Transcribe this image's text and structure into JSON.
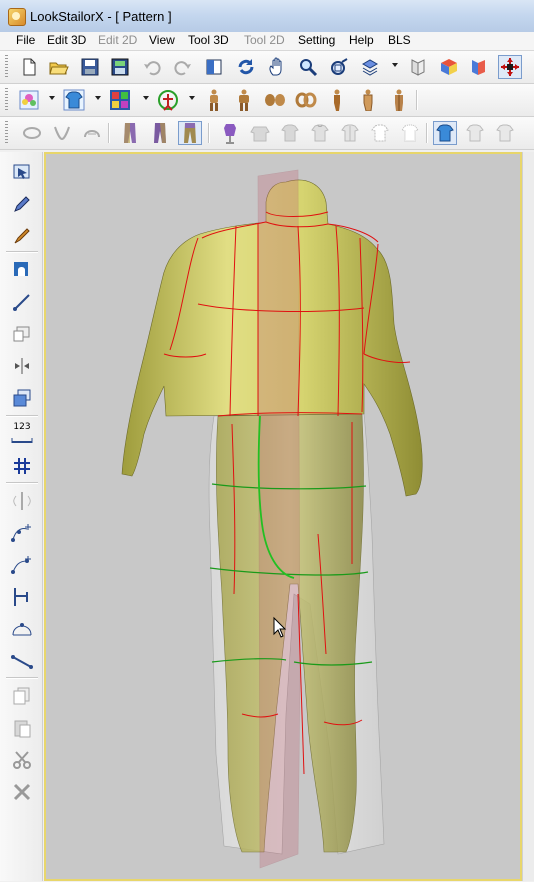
{
  "window": {
    "title": "LookStailorX - [ Pattern  ]"
  },
  "menu": [
    {
      "label": "File",
      "enabled": true
    },
    {
      "label": "Edit 3D",
      "enabled": true
    },
    {
      "label": "Edit 2D",
      "enabled": false
    },
    {
      "label": "View",
      "enabled": true
    },
    {
      "label": "Tool 3D",
      "enabled": true
    },
    {
      "label": "Tool 2D",
      "enabled": false
    },
    {
      "label": "Setting",
      "enabled": true
    },
    {
      "label": "Help",
      "enabled": true
    },
    {
      "label": "BLS",
      "enabled": true
    }
  ],
  "toolbar_main": [
    "new-icon",
    "open-icon",
    "save-icon",
    "save-all-icon",
    "undo-icon",
    "redo-icon",
    "split-view-icon",
    "rotate-icon",
    "pan-hand-icon",
    "zoom-icon",
    "fit-view-icon",
    "layers-icon",
    "display-mode-icon",
    "front-side-icon",
    "sculpt-icon",
    "move-axis-icon"
  ],
  "toolbar_body": [
    "texture-icon",
    "garment-icon",
    "grid-color-icon",
    "avatar-pose-icon",
    "body-front-icon",
    "body-back-icon",
    "body-parts-icon",
    "body-segments-icon",
    "body-side-icon",
    "body-outline-icon",
    "body-mirror-icon"
  ],
  "toolbar_garment": [
    "collar-round-icon",
    "collar-v-icon",
    "collar-hood-icon",
    "pants-long-icon",
    "pants-wide-icon",
    "pants-active-icon",
    "dress-form-icon",
    "top-plain-icon",
    "top-short-icon",
    "top-crew-icon",
    "top-open-icon",
    "shirt-outline-icon",
    "shirt-check-icon",
    "shirt-blue-icon",
    "shirt-long-icon",
    "shirt-casual-icon"
  ],
  "left_tools": {
    "ruler_label": "123",
    "items": [
      "select-pattern-icon",
      "pencil-icon",
      "brush-icon",
      "texture-move-icon",
      "line-draw-icon",
      "copy-shape-icon",
      "symmetry-icon",
      "layer-stack-icon",
      "measure-123-icon",
      "grid-snap-icon",
      "mirror-line-icon",
      "curve-add-icon",
      "curve-edit-icon",
      "seam-join-icon",
      "arc-icon",
      "straight-icon",
      "copy-icon",
      "paste-icon",
      "cut-icon",
      "delete-icon"
    ]
  },
  "colors": {
    "body": "#d3d06a",
    "body_shade": "#9d9b3a",
    "pattern_line": "#e01010",
    "guide_line": "#1a9a1a",
    "plane": "#c06a78",
    "viewport_bg": "#c8c8c8",
    "viewport_border": "#e8d66b"
  }
}
